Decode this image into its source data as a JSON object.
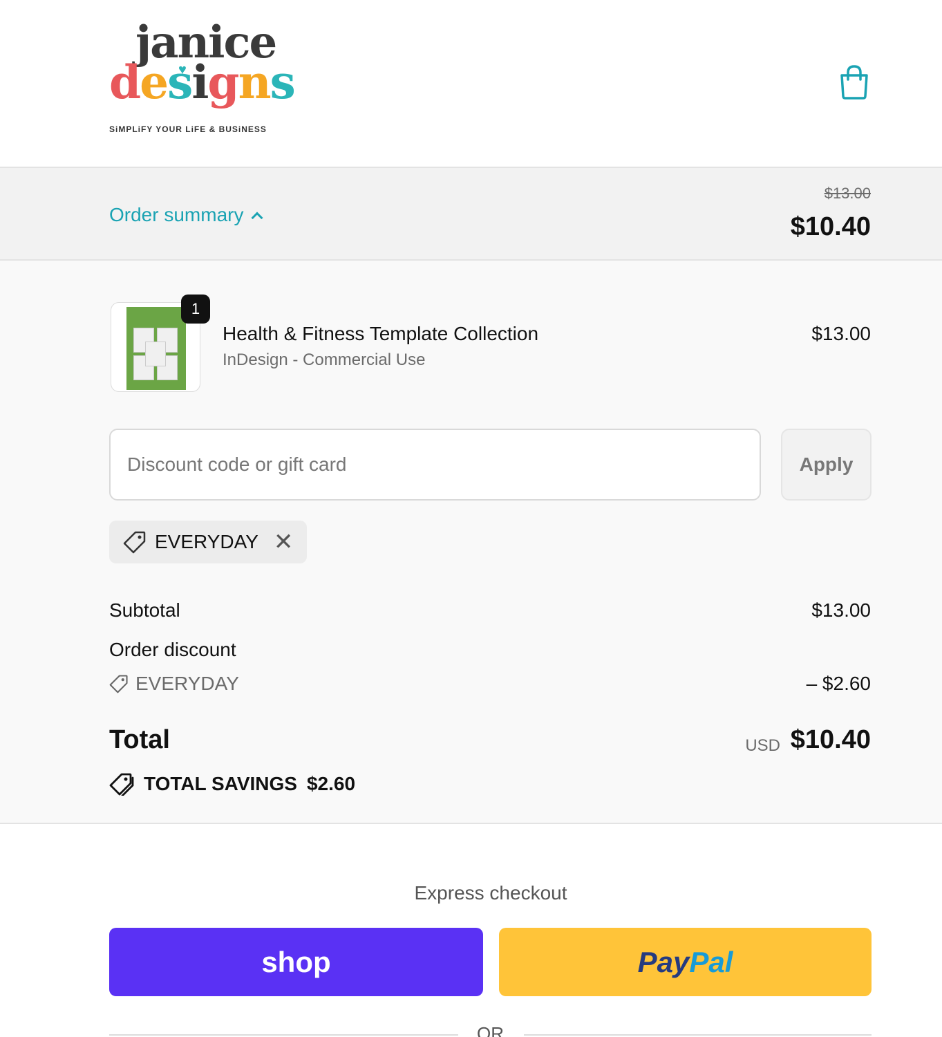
{
  "brand": {
    "logo_word_1": "janice",
    "logo_word_2": "designs",
    "tagline": "SiMPLiFY YOUR LiFE & BUSiNESS"
  },
  "summary_bar": {
    "toggle_label": "Order summary",
    "original_price": "$13.00",
    "price": "$10.40"
  },
  "line_item": {
    "quantity": "1",
    "name": "Health & Fitness Template Collection",
    "variant": "InDesign - Commercial Use",
    "price": "$13.00"
  },
  "discount": {
    "placeholder": "Discount code or gift card",
    "apply_label": "Apply",
    "applied_code": "EVERYDAY"
  },
  "totals": {
    "subtotal_label": "Subtotal",
    "subtotal_value": "$13.00",
    "discount_label": "Order discount",
    "discount_code": "EVERYDAY",
    "discount_value": "– $2.60",
    "total_label": "Total",
    "currency": "USD",
    "total_value": "$10.40",
    "savings_label": "TOTAL SAVINGS",
    "savings_value": "$2.60"
  },
  "express": {
    "label": "Express checkout",
    "shop_label": "shop",
    "paypal_part1": "Pay",
    "paypal_part2": "Pal",
    "or_label": "OR"
  },
  "colors": {
    "accent": "#1aa3b3",
    "shop_purple": "#5a31f4",
    "paypal_yellow": "#ffc439"
  }
}
